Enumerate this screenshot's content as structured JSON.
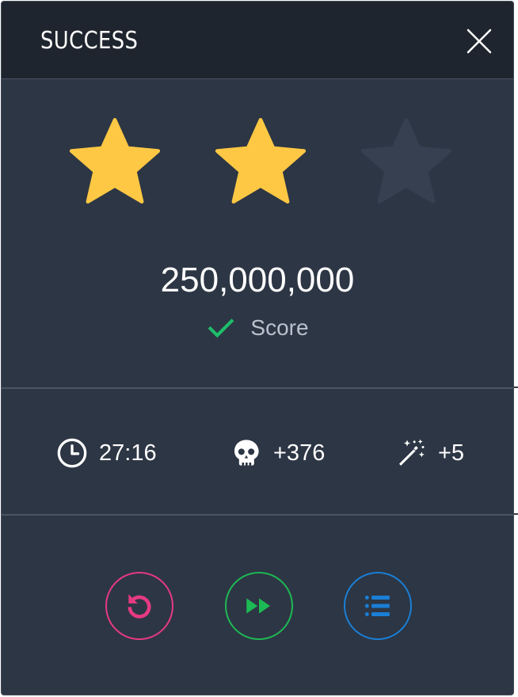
{
  "dialog": {
    "title": "SUCCESS",
    "close_icon": "close-icon"
  },
  "rating": {
    "stars_earned": 2,
    "stars_total": 3,
    "colors": {
      "earned": "#ffc844",
      "empty": "#364050"
    }
  },
  "score": {
    "value": "250,000,000",
    "label": "Score",
    "icon": "check-icon",
    "icon_color": "#1ebe6a"
  },
  "stats": {
    "time": {
      "icon": "clock-icon",
      "value": "27:16"
    },
    "kills": {
      "icon": "skull-icon",
      "value": "+376"
    },
    "magic": {
      "icon": "magic-wand-icon",
      "value": "+5"
    }
  },
  "actions": {
    "retry": {
      "icon": "retry-icon",
      "color": "#e63a82"
    },
    "next": {
      "icon": "fast-forward-icon",
      "color": "#1db954"
    },
    "levels": {
      "icon": "list-icon",
      "color": "#1a7fd6"
    }
  },
  "colors": {
    "background": "#2d3644",
    "header": "#1f252e",
    "divider": "#4a5463",
    "text": "#ffffff",
    "muted_text": "#b9c1cc"
  }
}
